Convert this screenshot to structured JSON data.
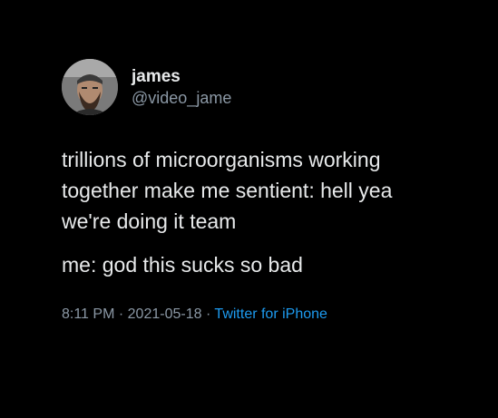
{
  "tweet": {
    "author": {
      "name": "james",
      "handle": "@video_jame"
    },
    "lines": [
      "trillions of microorganisms working",
      "together make me sentient: hell yea",
      "we're doing it team"
    ],
    "reply_line": "me: god this sucks so bad",
    "time": "8:11 PM",
    "separator": "·",
    "date": "2021-05-18",
    "source": "Twitter for iPhone"
  },
  "colors": {
    "background": "#000000",
    "text": "#e7e9ea",
    "muted": "#8b98a5",
    "link": "#1d9bf0"
  }
}
